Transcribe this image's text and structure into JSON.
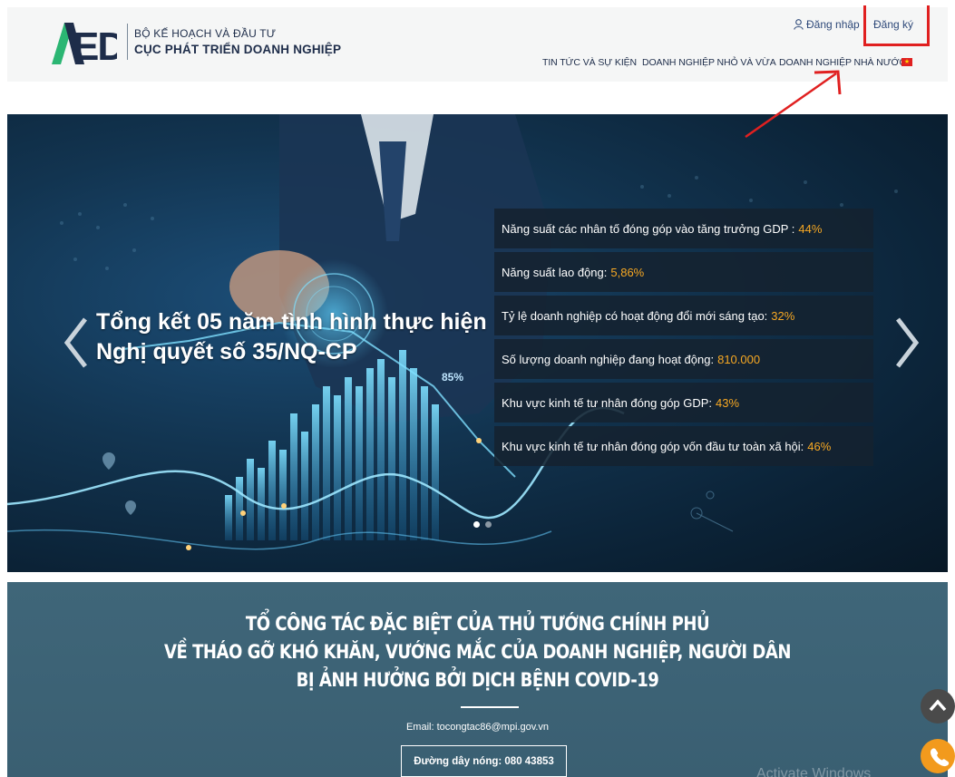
{
  "header": {
    "org_parent": "BỘ KẾ HOẠCH VÀ ĐẦU TƯ",
    "org_name": "CỤC PHÁT TRIỂN DOANH NGHIỆP",
    "logo_text": "AED",
    "login_label": "Đăng nhập",
    "register_label": "Đăng ký",
    "nav": [
      "TIN TỨC VÀ SỰ KIỆN",
      "DOANH NGHIỆP NHỎ VÀ VỪA",
      "DOANH NGHIỆP NHÀ NƯỚC"
    ],
    "language_icon": "vietnam-flag-icon"
  },
  "hero": {
    "title": "Tổng kết 05 năm tình hình thực hiện Nghị quyết số 35/NQ-CP",
    "chart_label": "85%",
    "stats": [
      {
        "label": "Năng suất các nhân tố đóng góp vào tăng trưởng GDP :",
        "value": "44%"
      },
      {
        "label": "Năng suất lao động:",
        "value": "5,86%"
      },
      {
        "label": "Tỷ lệ doanh nghiệp có hoạt động đổi mới sáng tạo:",
        "value": "32%"
      },
      {
        "label": "Số lượng doanh nghiệp đang hoạt động:",
        "value": "810.000"
      },
      {
        "label": "Khu vực kinh tế tư nhân đóng góp GDP:",
        "value": "43%"
      },
      {
        "label": "Khu vực kinh tế tư nhân đóng góp vốn đầu tư toàn xã hội:",
        "value": "46%"
      }
    ],
    "slide_count": 2,
    "active_slide": 1
  },
  "banner": {
    "line1": "TỔ CÔNG TÁC ĐẶC BIỆT CỦA THỦ TƯỚNG CHÍNH PHỦ",
    "line2": "VỀ THÁO GỠ KHÓ KHĂN, VƯỚNG MẮC CỦA DOANH NGHIỆP, NGƯỜI DÂN",
    "line3": "BỊ ẢNH HƯỞNG BỞI DỊCH BỆNH COVID-19",
    "email": "Email: tocongtac86@mpi.gov.vn",
    "hotline": "Đường dây nóng: 080 43853",
    "watermark": "Activate Windows"
  },
  "colors": {
    "accent_orange": "#f7a823",
    "banner_bg": "#3d6276",
    "annotation_red": "#e02020",
    "logo_green": "#2bb673",
    "logo_navy": "#1e2d4a"
  }
}
